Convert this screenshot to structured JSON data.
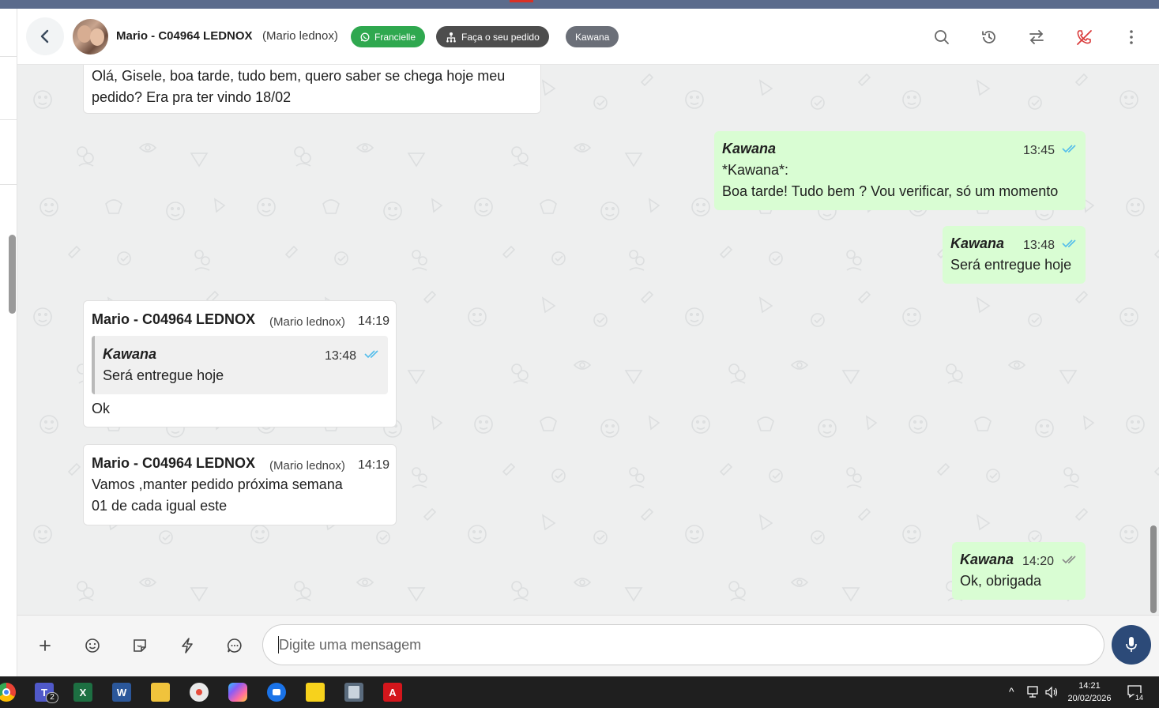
{
  "header": {
    "contact_name": "Mario - C04964 LEDNOX",
    "contact_alias": "(Mario lednox)",
    "tags": [
      {
        "label": "Francielle",
        "color": "#2fa84f",
        "icon": "whatsapp-icon"
      },
      {
        "label": "Faça o seu pedido",
        "color": "#4d4d4d",
        "icon": "hierarchy-icon"
      },
      {
        "label": "Kawana",
        "color": "#6b6f78"
      }
    ],
    "actions": [
      "search-icon",
      "history-icon",
      "transfer-icon",
      "end-call-icon",
      "more-vertical-icon"
    ]
  },
  "messages": [
    {
      "direction": "incoming",
      "lines": [
        "Olá, Gisele, boa tarde, tudo bem, quero saber se chega hoje meu",
        "pedido? Era pra ter vindo 18/02"
      ]
    },
    {
      "direction": "outgoing",
      "sender": "Kawana",
      "time": "13:45",
      "status": "read",
      "lines": [
        "*Kawana*:",
        "Boa tarde! Tudo bem ? Vou verificar, só um momento"
      ]
    },
    {
      "direction": "outgoing",
      "sender": "Kawana",
      "time": "13:48",
      "status": "read",
      "lines": [
        "Será entregue hoje"
      ]
    },
    {
      "direction": "incoming",
      "sender": "Mario - C04964 LEDNOX",
      "sender_alias": "(Mario lednox)",
      "time": "14:19",
      "quote": {
        "sender": "Kawana",
        "time": "13:48",
        "text": "Será entregue hoje"
      },
      "lines": [
        "Ok"
      ]
    },
    {
      "direction": "incoming",
      "sender": "Mario - C04964 LEDNOX",
      "sender_alias": "(Mario lednox)",
      "time": "14:19",
      "lines": [
        "Vamos ,manter pedido próxima semana",
        "01 de cada igual este"
      ]
    },
    {
      "direction": "outgoing",
      "sender": "Kawana",
      "time": "14:20",
      "status": "delivered",
      "lines": [
        "Ok, obrigada"
      ]
    }
  ],
  "composer": {
    "placeholder": "Digite uma mensagem",
    "tools": [
      "plus-icon",
      "emoji-icon",
      "sticker-icon",
      "quick-reply-icon",
      "chat-bubble-icon"
    ]
  },
  "taskbar": {
    "apps": [
      "chrome-icon",
      "teams-icon",
      "excel-icon",
      "word-icon",
      "file-explorer-icon",
      "paint-icon",
      "copilot-icon",
      "thunderbird-icon",
      "sticky-notes-icon",
      "calculator-icon",
      "acrobat-icon"
    ],
    "teams_badge": "2",
    "time": "14:21",
    "date": "20/02/2026",
    "notification_count": "14"
  },
  "colors": {
    "outgoing_bubble": "#d9fdd3",
    "incoming_bubble": "#ffffff",
    "read_ticks": "#53bdeb",
    "delivered_ticks": "#8a8a8a",
    "mic_button": "#2c4a78"
  }
}
